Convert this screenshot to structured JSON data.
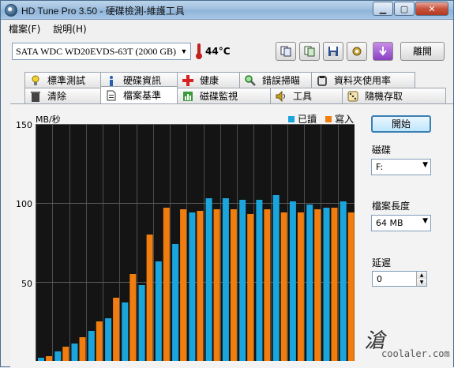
{
  "window": {
    "title": "HD Tune Pro 3.50 - 硬碟檢測-維護工具"
  },
  "menu": [
    {
      "label": "檔案(F)"
    },
    {
      "label": "說明(H)"
    }
  ],
  "toolbar": {
    "drive": "SATA  WDC WD20EVDS-63T (2000 GB)",
    "temperature": "44°C",
    "exit_label": "離開",
    "buttons": [
      "copy-info-icon",
      "copy-screen-icon",
      "save-icon",
      "options-icon",
      "download-icon"
    ]
  },
  "tabs_top": [
    {
      "label": "標準測試",
      "icon": "lightbulb-icon"
    },
    {
      "label": "硬碟資訊",
      "icon": "info-icon"
    },
    {
      "label": "健康",
      "icon": "health-cross-icon"
    },
    {
      "label": "錯誤掃瞄",
      "icon": "magnifier-icon"
    },
    {
      "label": "資料夾使用率",
      "icon": "folder-icon"
    }
  ],
  "tabs_bottom": [
    {
      "label": "清除",
      "icon": "trash-icon"
    },
    {
      "label": "檔案基準",
      "icon": "file-icon",
      "active": true
    },
    {
      "label": "磁碟監視",
      "icon": "monitor-icon"
    },
    {
      "label": "工具",
      "icon": "speaker-icon"
    },
    {
      "label": "隨機存取",
      "icon": "dice-icon"
    }
  ],
  "side": {
    "start_label": "開始",
    "disk_label": "磁碟",
    "disk_value": "F:",
    "file_length_label": "檔案長度",
    "file_length_value": "64 MB",
    "delay_label": "延遲",
    "delay_value": "0"
  },
  "watermark": {
    "glyph": "滄",
    "text": "coolaler.com"
  },
  "chart_data": {
    "type": "bar",
    "unit_label": "MB/秒",
    "ylim": [
      0,
      150
    ],
    "yticks": [
      "150",
      "100",
      "50"
    ],
    "ytick_values": [
      150,
      100,
      50
    ],
    "series": [
      {
        "name": "已讀",
        "color": "#1aa5dc",
        "values": [
          2,
          6,
          11,
          19,
          27,
          37,
          48,
          63,
          74,
          94,
          103,
          103,
          102,
          102,
          105,
          101,
          99,
          97,
          101
        ]
      },
      {
        "name": "寫入",
        "color": "#f07d0e",
        "values": [
          3,
          9,
          15,
          25,
          40,
          55,
          80,
          97,
          96,
          95,
          96,
          96,
          93,
          96,
          94,
          94,
          96,
          97,
          94
        ]
      }
    ]
  }
}
